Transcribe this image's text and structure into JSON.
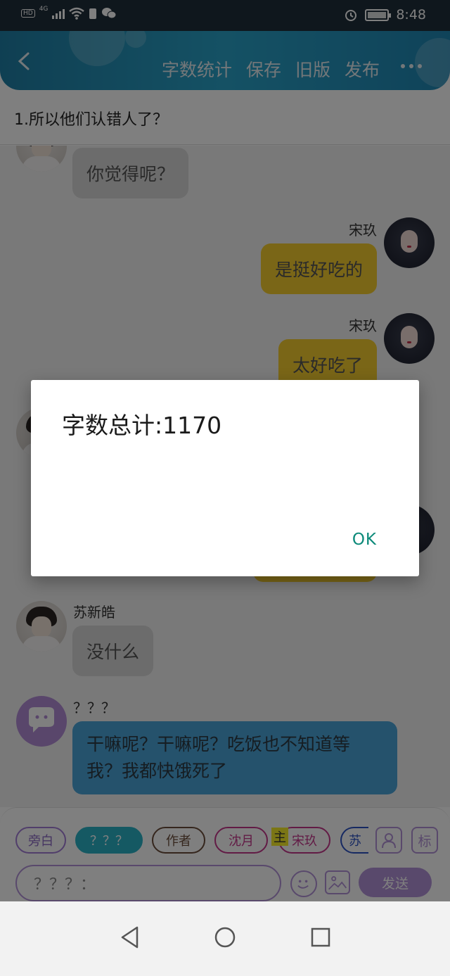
{
  "status_bar": {
    "hd": "HD",
    "network": "4G",
    "time": "8:48"
  },
  "app_bar": {
    "actions": [
      "字数统计",
      "保存",
      "旧版",
      "发布"
    ]
  },
  "chapter": {
    "title": "1.所以他们认错人了？"
  },
  "messages": [
    {
      "text": "你觉得呢？"
    },
    {
      "sender": "宋玖",
      "text": "是挺好吃的"
    },
    {
      "sender": "宋玖",
      "text": "太好吃了"
    },
    {
      "sender": "苏新皓",
      "text": "没什么"
    },
    {
      "sender": "？？？",
      "text": "干嘛呢？干嘛呢？吃饭也不知道等我？我都快饿死了"
    }
  ],
  "composer": {
    "roles": [
      "旁白",
      "？？？",
      "作者",
      "沈月",
      "宋玖",
      "苏"
    ],
    "main_tag": "主",
    "mark_label": "标",
    "input_value": "？？？：",
    "send_label": "发送"
  },
  "dialog": {
    "message": "字数总计:1170",
    "ok_label": "OK"
  }
}
